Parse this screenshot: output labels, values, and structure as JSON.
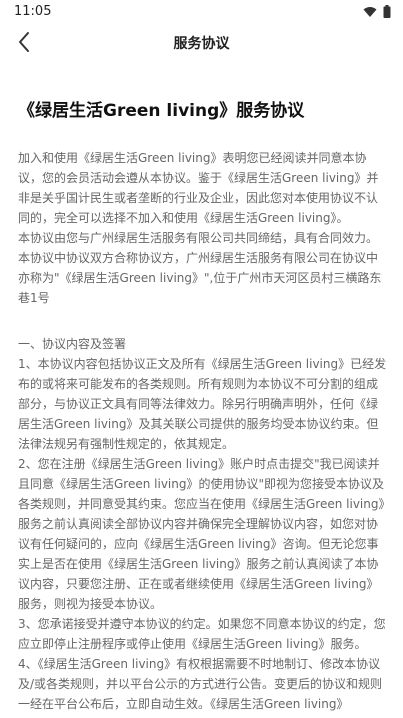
{
  "status": {
    "time": "11:05"
  },
  "header": {
    "title": "服务协议"
  },
  "document": {
    "title": "《绿居生活Green living》服务协议",
    "intro": [
      "加入和使用《绿居生活Green living》表明您已经阅读并同意本协议，您的会员活动会遵从本协议。鉴于《绿居生活Green living》并非是关乎国计民生或者垄断的行业及企业，因此您对本使用协议不认同的，完全可以选择不加入和使用《绿居生活Green living》。",
      "本协议由您与广州绿居生活服务有限公司共同缔结，具有合同效力。",
      "本协议中协议双方合称协议方，广州绿居生活服务有限公司在协议中亦称为\"《绿居生活Green living》\",位于广州市天河区员村三横路东巷1号"
    ],
    "section1_heading": "一、协议内容及签署",
    "section1": [
      "1、本协议内容包括协议正文及所有《绿居生活Green living》已经发布的或将来可能发布的各类规则。所有规则为本协议不可分割的组成部分，与协议正文具有同等法律效力。除另行明确声明外，任何《绿居生活Green living》及其关联公司提供的服务均受本协议约束。但法律法规另有强制性规定的，依其规定。",
      "2、您在注册《绿居生活Green living》账户时点击提交\"我已阅读并且同意《绿居生活Green living》的使用协议\"即视为您接受本协议及各类规则，并同意受其约束。您应当在使用《绿居生活Green living》服务之前认真阅读全部协议内容并确保完全理解协议内容，如您对协议有任何疑问的，应向《绿居生活Green living》咨询。但无论您事实上是否在使用《绿居生活Green living》服务之前认真阅读了本协议内容，只要您注册、正在或者继续使用《绿居生活Green living》服务，则视为接受本协议。",
      "3、您承诺接受并遵守本协议的约定。如果您不同意本协议的约定，您应立即停止注册程序或停止使用《绿居生活Green living》服务。",
      "4、《绿居生活Green living》有权根据需要不时地制订、修改本协议及/或各类规则，并以平台公示的方式进行公告。变更后的协议和规则一经在平台公布后，立即自动生效。《绿居生活Green living》"
    ]
  }
}
